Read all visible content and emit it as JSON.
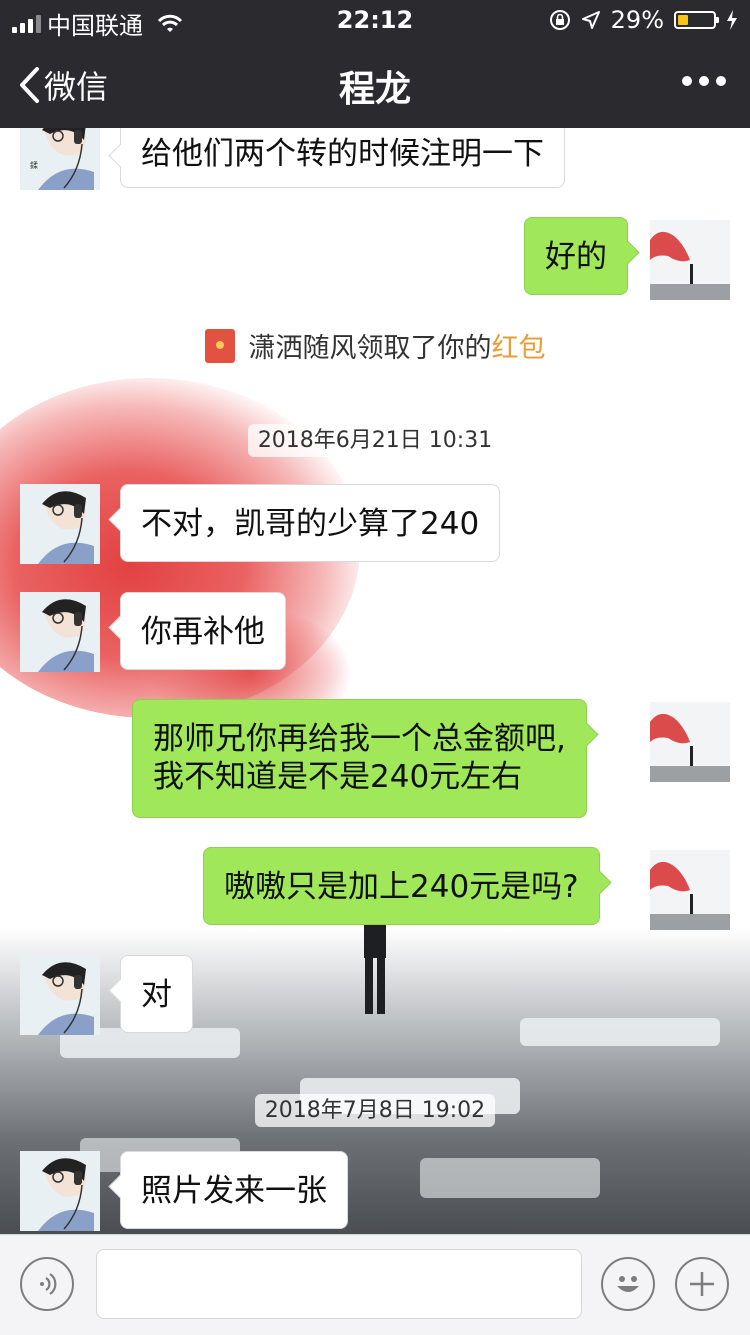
{
  "status_bar": {
    "carrier": "中国联通",
    "time": "22:12",
    "battery": "29%",
    "battery_level": 0.29
  },
  "nav": {
    "back_label": "微信",
    "title": "程龙"
  },
  "messages": {
    "m1": "给他们两个转的时候注明一下",
    "m2": "好的",
    "system_prefix": "潇洒随风领取了你的",
    "system_link": "红包",
    "ts1": "2018年6月21日 10:31",
    "m3": "不对，凯哥的少算了240",
    "m4": "你再补他",
    "m5_line1": "那师兄你再给我一个总金额吧,",
    "m5_line2": "我不知道是不是240元左右",
    "m6": "嗷嗷只是加上240元是吗?",
    "m7": "对",
    "ts2": "2018年7月8日 19:02",
    "m8": "照片发来一张"
  },
  "input_bar": {
    "placeholder": ""
  },
  "colors": {
    "sent_bubble": "#a0e75a",
    "nav_bg": "#2b2b2f",
    "link": "#e89c36"
  },
  "icons": [
    "back-chevron-icon",
    "more-icon",
    "voice-icon",
    "emoji-icon",
    "plus-icon",
    "red-packet-icon"
  ]
}
